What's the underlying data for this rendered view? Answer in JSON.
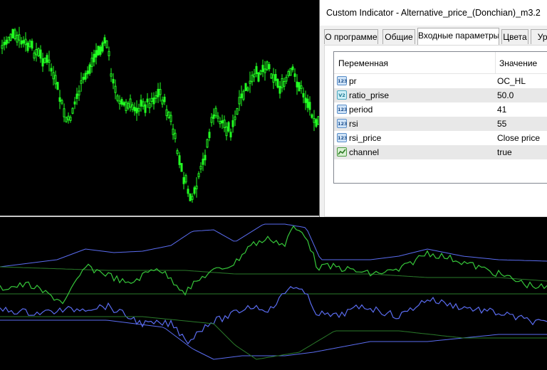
{
  "dialog": {
    "title": "Custom Indicator - Alternative_price_(Donchian)_m3.2",
    "tabs": [
      {
        "label": "О программе",
        "active": false
      },
      {
        "label": "Общие",
        "active": false
      },
      {
        "label": "Входные параметры",
        "active": true
      },
      {
        "label": "Цвета",
        "active": false
      },
      {
        "label": "Уро",
        "active": false
      }
    ],
    "table": {
      "headers": {
        "variable": "Переменная",
        "value": "Значение"
      },
      "rows": [
        {
          "icon": "integer-icon",
          "icon_text": "123",
          "variable": "pr",
          "value": "OC_HL"
        },
        {
          "icon": "double-icon",
          "icon_text": "V2",
          "variable": "ratio_prise",
          "value": "50.0"
        },
        {
          "icon": "integer-icon",
          "icon_text": "123",
          "variable": "period",
          "value": "41"
        },
        {
          "icon": "integer-icon",
          "icon_text": "123",
          "variable": "rsi",
          "value": "55"
        },
        {
          "icon": "integer-icon",
          "icon_text": "123",
          "variable": "rsi_price",
          "value": "Close price"
        },
        {
          "icon": "bool-icon",
          "icon_text": "",
          "variable": "channel",
          "value": "true"
        }
      ]
    }
  },
  "colors": {
    "background": "#000000",
    "candles": "#22ff22",
    "green_line": "#36c83a",
    "dark_green_line": "#2a7a2a",
    "blue_line": "#5a6cf0"
  }
}
